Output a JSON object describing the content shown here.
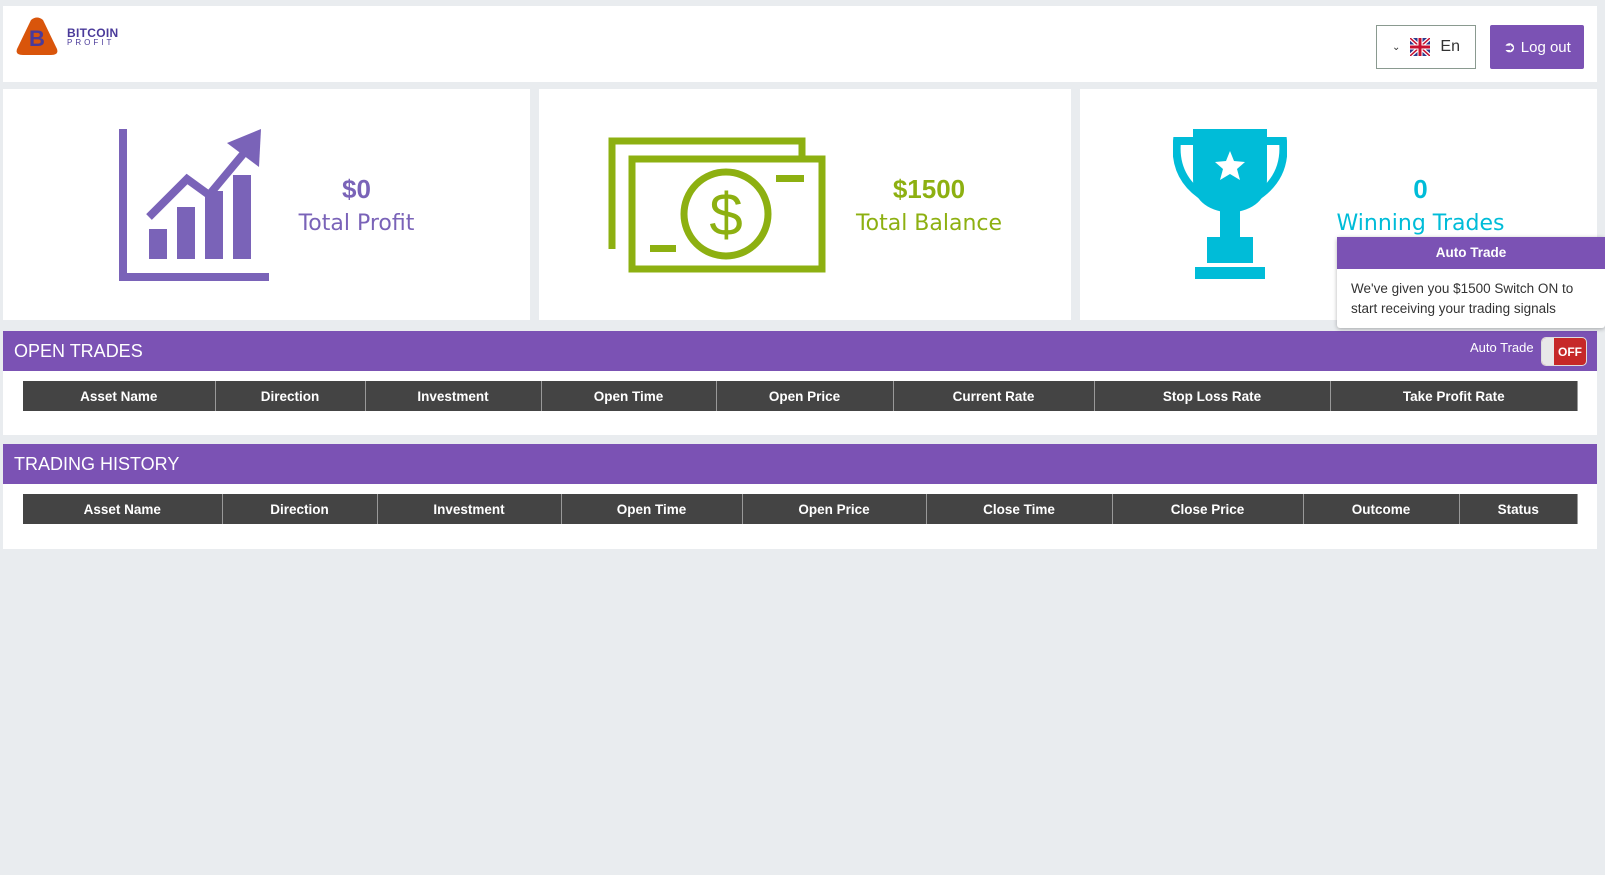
{
  "brand": {
    "line1": "BITCOIN",
    "line2": "PROFIT",
    "logo_color": "#d9550b"
  },
  "header": {
    "language": "En",
    "logout": "Log out"
  },
  "stats": [
    {
      "value": "$0",
      "label": "Total Profit",
      "color": "#7a63b8",
      "icon": "chart-growth-icon"
    },
    {
      "value": "$1500",
      "label": "Total Balance",
      "color": "#8db011",
      "icon": "money-bill-icon"
    },
    {
      "value": "0",
      "label": "Winning Trades",
      "color": "#00bcd8",
      "icon": "trophy-icon"
    }
  ],
  "open_trades": {
    "title": "OPEN TRADES",
    "auto_trade_label": "Auto Trade",
    "toggle_state": "OFF",
    "columns": [
      "Asset Name",
      "Direction",
      "Investment",
      "Open Time",
      "Open Price",
      "Current Rate",
      "Stop Loss Rate",
      "Take Profit Rate"
    ]
  },
  "tooltip": {
    "title": "Auto Trade",
    "text": "We've given you $1500 Switch ON to start receiving your trading signals"
  },
  "trading_history": {
    "title": "TRADING HISTORY",
    "columns": [
      "Asset Name",
      "Direction",
      "Investment",
      "Open Time",
      "Open Price",
      "Close Time",
      "Close Price",
      "Outcome",
      "Status"
    ]
  },
  "colors": {
    "accent": "#7b52b4",
    "off": "#c62828"
  }
}
